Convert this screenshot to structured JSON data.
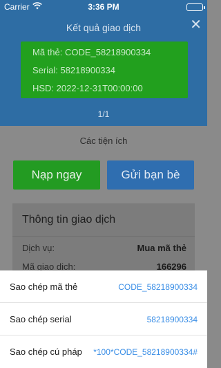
{
  "status_bar": {
    "carrier": "Carrier",
    "time": "3:36 PM"
  },
  "header": {
    "title": "Kết quả giao dịch",
    "close_glyph": "✕",
    "card": {
      "code_line": "Mã thẻ: CODE_58218900334",
      "serial_line": "Serial: 58218900334",
      "expiry_line": "HSD: 2022-12-31T00:00:00"
    },
    "pager": "1/1"
  },
  "utilities": {
    "title": "Các tiện ích",
    "recharge_label": "Nạp ngay",
    "send_label": "Gửi bạn bè"
  },
  "transaction_info": {
    "title": "Thông tin giao dịch",
    "rows": [
      {
        "label": "Dịch vụ:",
        "value": "Mua mã thẻ"
      },
      {
        "label": "Mã giao dịch:",
        "value": "166296"
      }
    ]
  },
  "action_sheet": {
    "items": [
      {
        "label": "Sao chép mã thẻ",
        "value": "CODE_58218900334"
      },
      {
        "label": "Sao chép serial",
        "value": "58218900334"
      },
      {
        "label": "Sao chép cú pháp",
        "value": "*100*CODE_58218900334#"
      }
    ]
  },
  "colors": {
    "header_blue": "#2e6da4",
    "card_green": "#22a01e",
    "link_blue": "#3a8ee6"
  }
}
